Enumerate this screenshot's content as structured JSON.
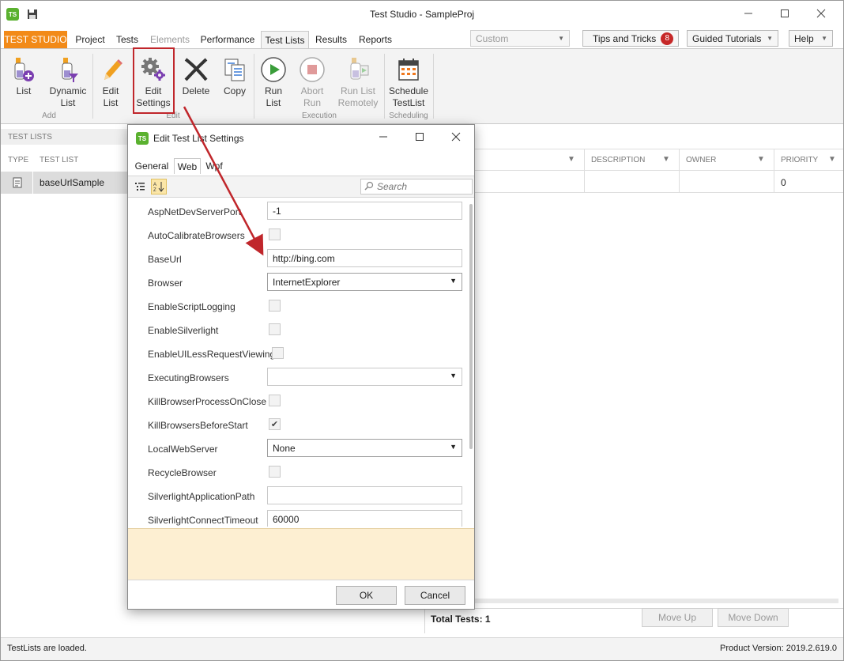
{
  "window": {
    "title": "Test Studio - SampleProj",
    "app_icon": "TS"
  },
  "menu": {
    "brand": "TEST STUDIO",
    "tabs": [
      {
        "label": "Project",
        "state": "normal"
      },
      {
        "label": "Tests",
        "state": "normal"
      },
      {
        "label": "Elements",
        "state": "disabled"
      },
      {
        "label": "Performance",
        "state": "normal"
      },
      {
        "label": "Test Lists",
        "state": "active"
      },
      {
        "label": "Results",
        "state": "normal"
      },
      {
        "label": "Reports",
        "state": "normal"
      }
    ],
    "layout_select": "Custom",
    "tips_label": "Tips and Tricks",
    "tips_count": "8",
    "tutorials_label": "Guided Tutorials",
    "help_label": "Help"
  },
  "ribbon": {
    "groups": [
      {
        "label": "Add",
        "buttons": [
          {
            "line1": "List",
            "line2": ""
          },
          {
            "line1": "Dynamic",
            "line2": "List"
          }
        ]
      },
      {
        "label": "Edit",
        "buttons": [
          {
            "line1": "Edit",
            "line2": "List"
          },
          {
            "line1": "Edit",
            "line2": "Settings"
          },
          {
            "line1": "Delete",
            "line2": ""
          },
          {
            "line1": "Copy",
            "line2": ""
          }
        ]
      },
      {
        "label": "Execution",
        "buttons": [
          {
            "line1": "Run",
            "line2": "List"
          },
          {
            "line1": "Abort",
            "line2": "Run"
          },
          {
            "line1": "Run List",
            "line2": "Remotely"
          }
        ]
      },
      {
        "label": "Scheduling",
        "buttons": [
          {
            "line1": "Schedule",
            "line2": "TestList"
          }
        ]
      }
    ]
  },
  "left_panel": {
    "header": "TEST LISTS",
    "columns": [
      "TYPE",
      "TEST LIST"
    ],
    "rows": [
      {
        "name": "baseUrlSample"
      }
    ]
  },
  "right_panel": {
    "columns": [
      "DESCRIPTION",
      "OWNER",
      "PRIORITY"
    ],
    "rows": [
      {
        "priority": "0"
      }
    ],
    "total_tests": "Total Tests: 1",
    "move_up": "Move Up",
    "move_down": "Move Down"
  },
  "status": {
    "message": "TestLists are loaded.",
    "version": "Product Version: 2019.2.619.0"
  },
  "dialog": {
    "title": "Edit Test List Settings",
    "tabs": [
      "General",
      "Web",
      "Wpf"
    ],
    "active_tab": "Web",
    "search_placeholder": "Search",
    "properties": [
      {
        "name": "AspNetDevServerPort",
        "kind": "text",
        "value": "-1"
      },
      {
        "name": "AutoCalibrateBrowsers",
        "kind": "check",
        "value": ""
      },
      {
        "name": "BaseUrl",
        "kind": "text",
        "value": "http://bing.com"
      },
      {
        "name": "Browser",
        "kind": "select",
        "value": "InternetExplorer"
      },
      {
        "name": "EnableScriptLogging",
        "kind": "check",
        "value": ""
      },
      {
        "name": "EnableSilverlight",
        "kind": "check",
        "value": ""
      },
      {
        "name": "EnableUILessRequestViewing",
        "kind": "check",
        "value": ""
      },
      {
        "name": "ExecutingBrowsers",
        "kind": "select",
        "value": ""
      },
      {
        "name": "KillBrowserProcessOnClose",
        "kind": "check",
        "value": ""
      },
      {
        "name": "KillBrowsersBeforeStart",
        "kind": "check",
        "value": "✔"
      },
      {
        "name": "LocalWebServer",
        "kind": "select",
        "value": "None"
      },
      {
        "name": "RecycleBrowser",
        "kind": "check",
        "value": ""
      },
      {
        "name": "SilverlightApplicationPath",
        "kind": "text",
        "value": ""
      },
      {
        "name": "SilverlightConnectTimeout",
        "kind": "text",
        "value": "60000"
      }
    ],
    "ok_label": "OK",
    "cancel_label": "Cancel"
  },
  "colors": {
    "brand_orange": "#f28a18",
    "highlight_red": "#c0262b",
    "ts_green": "#5ab12f",
    "description_bg": "#fdefd2"
  }
}
